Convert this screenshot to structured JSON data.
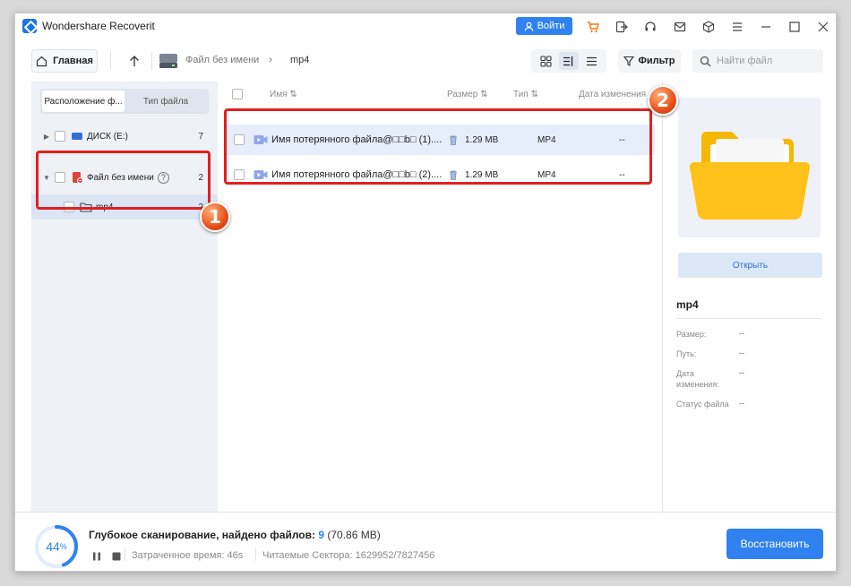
{
  "app": {
    "title": "Wondershare Recoverit",
    "login_label": "Войти"
  },
  "toolbar": {
    "home_label": "Главная",
    "breadcrumb": [
      "Файл без имени",
      "mp4"
    ],
    "filter_label": "Фильтр",
    "search_placeholder": "Найти файл"
  },
  "left_panel": {
    "tabs": [
      "Расположение ф...",
      "Тип файла"
    ],
    "tree": [
      {
        "label": "ДИСК (E:)",
        "count": "7"
      },
      {
        "label": "Файл без имени",
        "help": "?",
        "count": "2"
      },
      {
        "label": "mp4",
        "count": "2"
      }
    ]
  },
  "file_list": {
    "columns": [
      "Имя ⇅",
      "Размер ⇅",
      "Тип ⇅",
      "Дата изменения"
    ],
    "rows": [
      {
        "name": "Имя потерянного файла@□□b□ (1)....",
        "size": "1.29 MB",
        "type": "MP4",
        "date": "--"
      },
      {
        "name": "Имя потерянного файла@□□b□ (2)....",
        "size": "1.29 MB",
        "type": "MP4",
        "date": "--"
      }
    ]
  },
  "details": {
    "open_label": "Открыть",
    "title": "mp4",
    "fields": [
      {
        "label": "Размер:",
        "value": "--"
      },
      {
        "label": "Путь:",
        "value": "--"
      },
      {
        "label": "Дата изменения:",
        "value": "--"
      },
      {
        "label": "Статус файла",
        "value": "--"
      }
    ]
  },
  "scan": {
    "percent": "44",
    "percent_sign": "%",
    "progress_fraction": 0.44,
    "title_prefix": "Глубокое сканирование, найдено файлов:",
    "found_count": "9",
    "found_size": "(70.86 MB)",
    "elapsed": "Затраченное время: 46s",
    "sectors": "Читаемые Сектора: 1629952/7827456",
    "restore_label": "Восстановить"
  },
  "annotations": {
    "badge1": "1",
    "badge2": "2",
    "color": "#e02020"
  },
  "colors": {
    "accent": "#2f82f0",
    "panel_bg": "#eef1f6",
    "selection": "#dbe5f4"
  }
}
